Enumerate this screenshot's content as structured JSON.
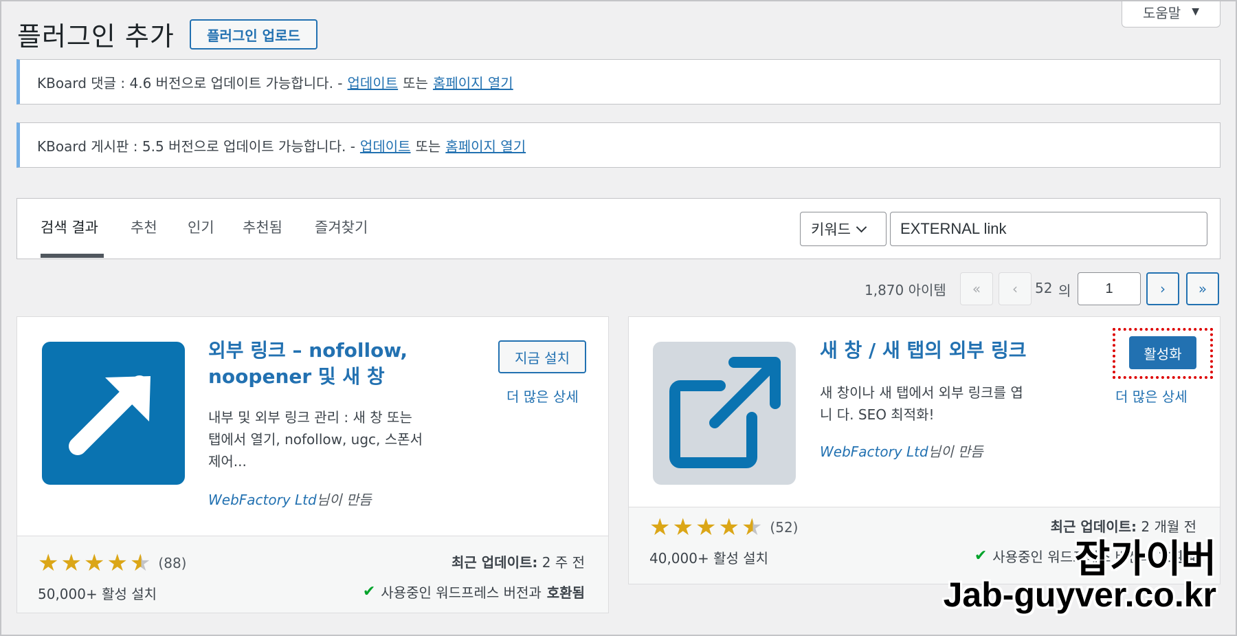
{
  "header": {
    "title": "플러그인 추가",
    "upload_label": "플러그인 업로드",
    "help_label": "도움말",
    "help_caret": "▼"
  },
  "notices": [
    {
      "text": "KBoard 댓글 : 4.6 버전으로 업데이트 가능합니다. -",
      "update_link": "업데이트",
      "or": "또는",
      "homepage_link": "홈페이지 열기"
    },
    {
      "text": "KBoard 게시판 : 5.5 버전으로 업데이트 가능합니다. -",
      "update_link": "업데이트",
      "or": "또는",
      "homepage_link": "홈페이지 열기"
    }
  ],
  "filter": {
    "tabs": [
      {
        "label": "검색 결과",
        "active": true
      },
      {
        "label": "추천",
        "active": false
      },
      {
        "label": "인기",
        "active": false
      },
      {
        "label": "추천됨",
        "active": false
      },
      {
        "label": "즐겨찾기",
        "active": false
      }
    ],
    "search_type": "키워드",
    "search_value": "EXTERNAL link"
  },
  "pagination": {
    "items_count": "1,870 아이템",
    "first": "«",
    "prev": "‹",
    "next": "›",
    "last": "»",
    "current_page": "1",
    "of_label": "의",
    "total_pages": "52"
  },
  "plugins": [
    {
      "name_line1": "외부 링크 – nofollow,",
      "name_line2": "noopener 및 새 창",
      "desc_line1": "내부 및 외부 링크 관리 : 새 창 또는",
      "desc_line2": "탭에서 열기, nofollow, ugc, 스폰서",
      "desc_line3": "제어...",
      "author": "WebFactory Ltd",
      "author_suffix": "님이 만듬",
      "action_label": "지금 설치",
      "more_label": "더 많은 상세",
      "rating": 4.5,
      "rating_count": "(88)",
      "installs": "50,000+ 활성 설치",
      "last_updated_label": "최근 업데이트:",
      "last_updated_value": "2 주 전",
      "compat_text": "사용중인 워드프레스 버전과",
      "compat_strong": "호환됨",
      "icon_bg": "#0a73b1"
    },
    {
      "name_line1": "새 창 / 새 탭의 외부 링크",
      "desc_line1": "새 창이나 새 탭에서 외부 링크를 엽",
      "desc_line2": "니 다. SEO 최적화!",
      "author": "WebFactory Ltd",
      "author_suffix": "님이 만듬",
      "action_label": "활성화",
      "more_label": "더 많은 상세",
      "rating": 4.5,
      "rating_count": "(52)",
      "installs": "40,000+ 활성 설치",
      "last_updated_label": "최근 업데이트:",
      "last_updated_value": "2 개월 전",
      "compat_text": "사용중인 워드프레스 버전과",
      "compat_strong": "호환됨",
      "icon_bg": "#d3d9df"
    }
  ],
  "watermark": {
    "line1": "잡가이버",
    "line2": "Jab-guyver.co.kr"
  },
  "colors": {
    "accent": "#2271b1",
    "notice_border": "#72aee6",
    "star": "#dba617",
    "highlight": "#dd0000"
  }
}
